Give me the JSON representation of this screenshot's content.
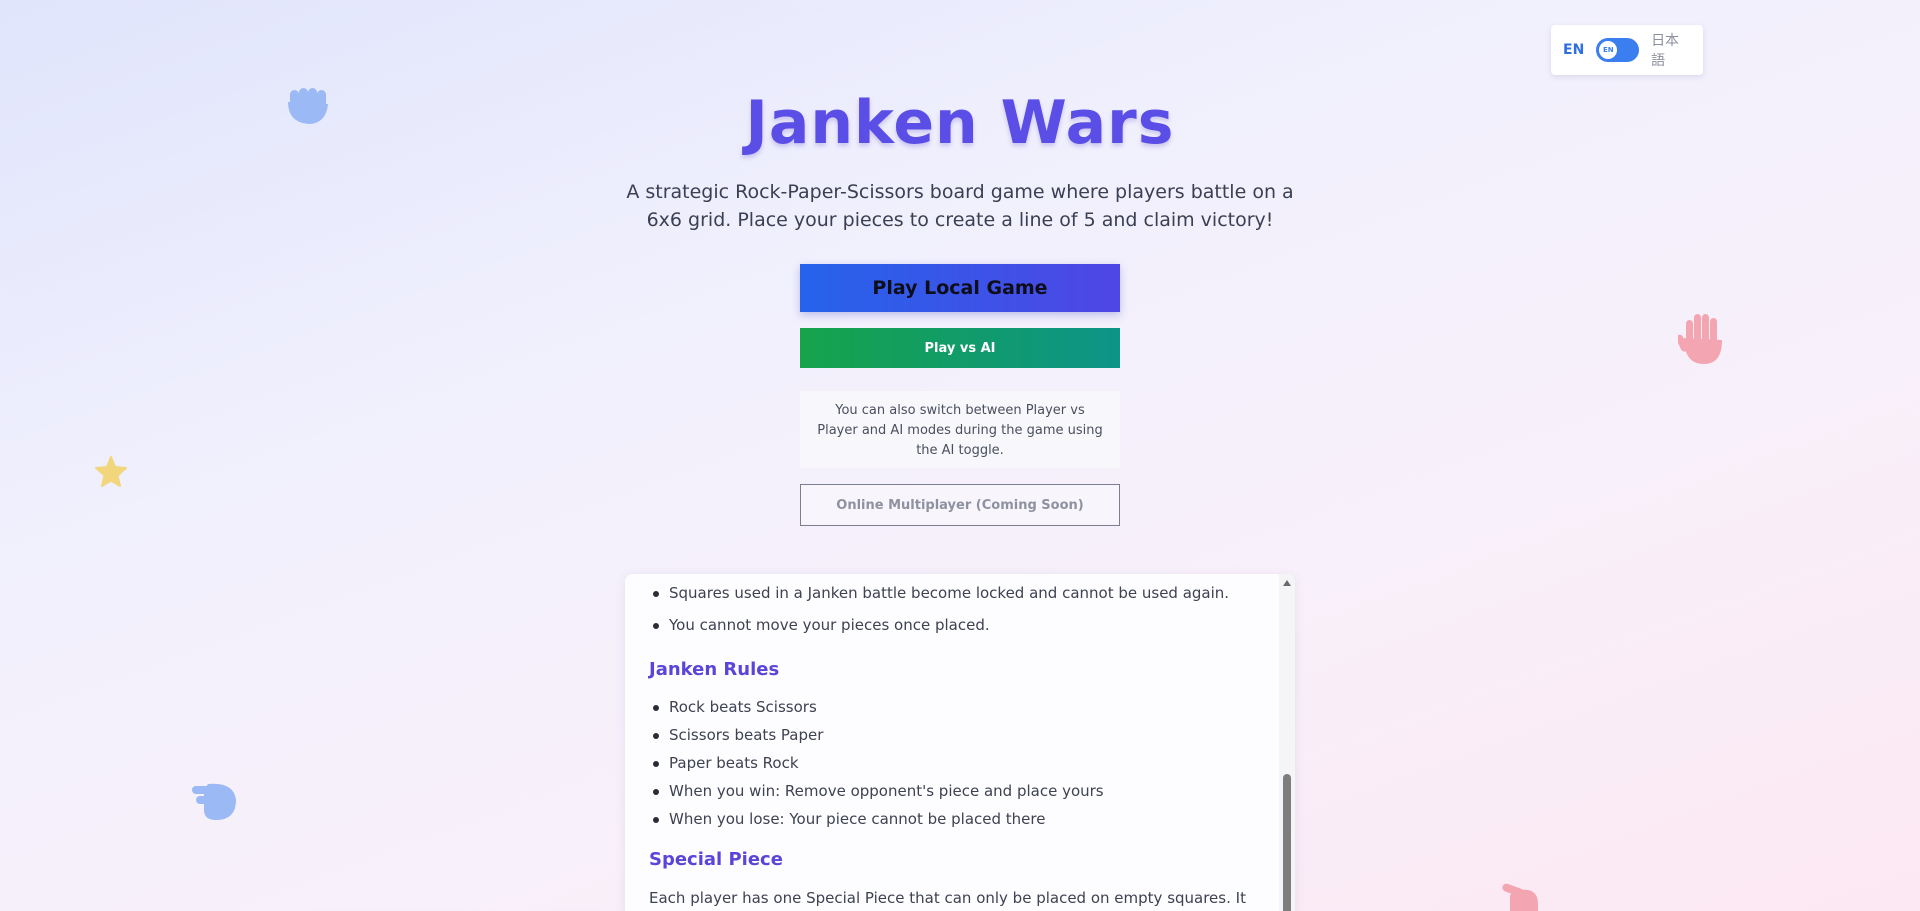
{
  "language": {
    "english_label": "EN",
    "japanese_label": "日本語",
    "knob_label": "EN"
  },
  "header": {
    "title": "Janken Wars",
    "subtitle": "A strategic Rock-Paper-Scissors board game where players battle on a 6x6 grid. Place your pieces to create a line of 5 and claim victory!"
  },
  "menu": {
    "play_local": "Play Local Game",
    "play_ai": "Play vs AI",
    "ai_note": "You can also switch between Player vs Player and AI modes during the game using the AI toggle.",
    "online": "Online Multiplayer (Coming Soon)"
  },
  "rules": {
    "general_items": [
      "Squares used in a Janken battle become locked and cannot be used again.",
      "You cannot move your pieces once placed."
    ],
    "janken_heading": "Janken Rules",
    "janken_items": [
      "Rock beats Scissors",
      "Scissors beats Paper",
      "Paper beats Rock",
      "When you win: Remove opponent's piece and place yours",
      "When you lose: Your piece cannot be placed there"
    ],
    "special_heading": "Special Piece",
    "special_text": "Each player has one Special Piece that can only be placed on empty squares. It cannot be captured and counts as part of your line."
  },
  "decorations": {
    "icons": [
      "rock-hand-icon",
      "paper-hand-icon",
      "star-icon",
      "pointing-hand-icon",
      "scissors-hand-icon"
    ],
    "colors": {
      "blue": "#9bb9f5",
      "pink": "#f3a6b2",
      "yellow": "#f1d67c"
    }
  },
  "colors": {
    "title": "#5b4ee6",
    "primary_gradient": [
      "#2563eb",
      "#4f46e5"
    ],
    "ai_gradient": [
      "#16a34a",
      "#0d9488"
    ],
    "heading": "#5b45d9"
  }
}
